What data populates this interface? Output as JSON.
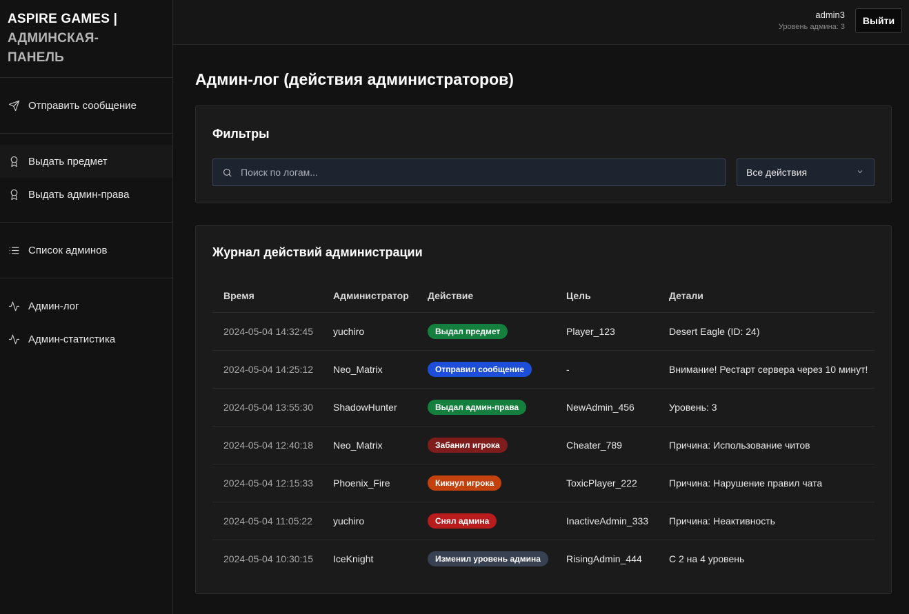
{
  "brand": {
    "line1": "ASPIRE GAMES |",
    "line2": "АДМИНСКАЯ-",
    "line3": "ПАНЕЛЬ"
  },
  "sidebar": {
    "groups": [
      [
        {
          "label": "Отправить сообщение",
          "icon": "send-icon"
        }
      ],
      [
        {
          "label": "Выдать предмет",
          "icon": "award-icon"
        },
        {
          "label": "Выдать админ-права",
          "icon": "award-icon"
        }
      ],
      [
        {
          "label": "Список админов",
          "icon": "list-icon"
        }
      ],
      [
        {
          "label": "Админ-лог",
          "icon": "activity-icon"
        },
        {
          "label": "Админ-статистика",
          "icon": "activity-icon"
        }
      ]
    ]
  },
  "header": {
    "username": "admin3",
    "level": "Уровень админа: 3",
    "logout_label": "Выйти"
  },
  "main": {
    "title": "Админ-лог (действия администраторов)",
    "filters": {
      "title": "Фильтры",
      "search_placeholder": "Поиск по логам...",
      "action_select": "Все действия"
    },
    "log": {
      "title": "Журнал действий администрации",
      "columns": [
        "Время",
        "Администратор",
        "Действие",
        "Цель",
        "Детали"
      ],
      "rows": [
        {
          "time": "2024-05-04 14:32:45",
          "admin": "yuchiro",
          "action": "Выдал предмет",
          "color": "#15803d",
          "target": "Player_123",
          "details": "Desert Eagle (ID: 24)"
        },
        {
          "time": "2024-05-04 14:25:12",
          "admin": "Neo_Matrix",
          "action": "Отправил сообщение",
          "color": "#1d4ed8",
          "target": "-",
          "details": "Внимание! Рестарт сервера через 10 минут!"
        },
        {
          "time": "2024-05-04 13:55:30",
          "admin": "ShadowHunter",
          "action": "Выдал админ-права",
          "color": "#15803d",
          "target": "NewAdmin_456",
          "details": "Уровень: 3"
        },
        {
          "time": "2024-05-04 12:40:18",
          "admin": "Neo_Matrix",
          "action": "Забанил игрока",
          "color": "#7f1d1d",
          "target": "Cheater_789",
          "details": "Причина: Использование читов"
        },
        {
          "time": "2024-05-04 12:15:33",
          "admin": "Phoenix_Fire",
          "action": "Кикнул игрока",
          "color": "#c2410c",
          "target": "ToxicPlayer_222",
          "details": "Причина: Нарушение правил чата"
        },
        {
          "time": "2024-05-04 11:05:22",
          "admin": "yuchiro",
          "action": "Снял админа",
          "color": "#b91c1c",
          "target": "InactiveAdmin_333",
          "details": "Причина: Неактивность"
        },
        {
          "time": "2024-05-04 10:30:15",
          "admin": "IceKnight",
          "action": "Изменил уровень админа",
          "color": "#374151",
          "target": "RisingAdmin_444",
          "details": "С 2 на 4 уровень"
        }
      ]
    }
  }
}
